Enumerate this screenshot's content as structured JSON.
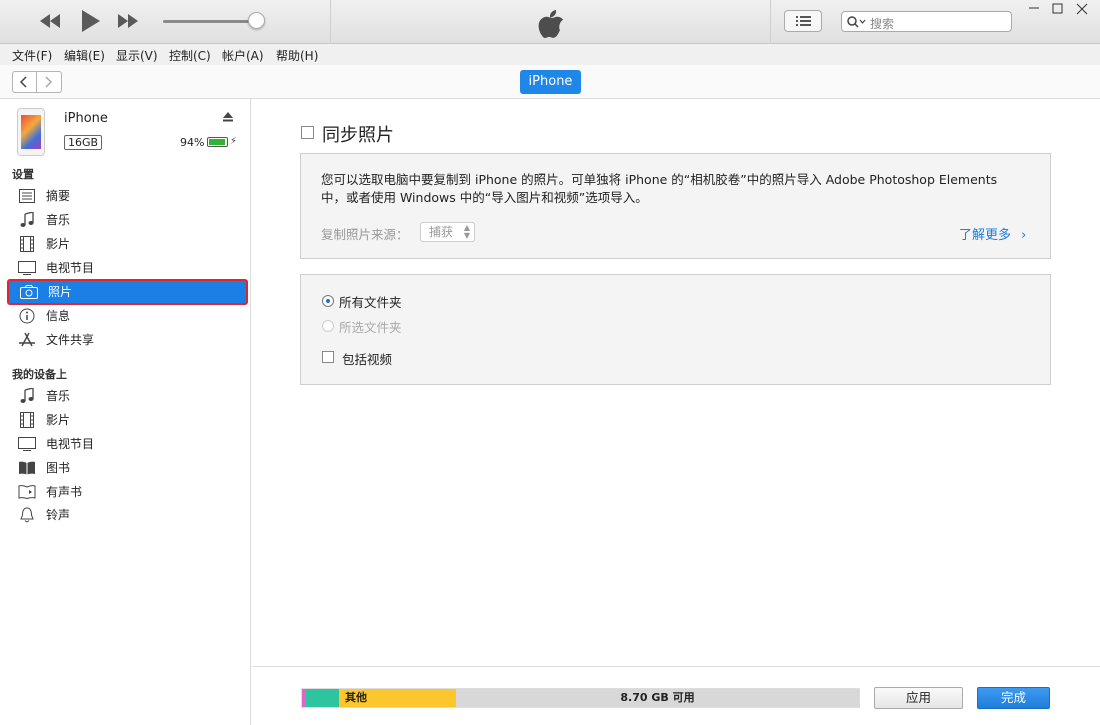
{
  "search": {
    "placeholder": "搜索"
  },
  "menu": [
    "文件(F)",
    "编辑(E)",
    "显示(V)",
    "控制(C)",
    "帐户(A)",
    "帮助(H)"
  ],
  "nav": {
    "device_pill": "iPhone"
  },
  "device": {
    "name": "iPhone",
    "capacity": "16GB",
    "battery_pct": "94%",
    "battery_level": 0.94
  },
  "sidebar": {
    "settings_header": "设置",
    "settings_items": [
      {
        "label": "摘要",
        "icon": "list-icon"
      },
      {
        "label": "音乐",
        "icon": "music-note-icon"
      },
      {
        "label": "影片",
        "icon": "film-icon"
      },
      {
        "label": "电视节目",
        "icon": "tv-icon"
      },
      {
        "label": "照片",
        "icon": "camera-icon",
        "selected": true
      },
      {
        "label": "信息",
        "icon": "info-icon"
      },
      {
        "label": "文件共享",
        "icon": "app-store-icon"
      }
    ],
    "device_header": "我的设备上",
    "device_items": [
      {
        "label": "音乐",
        "icon": "music-note-icon"
      },
      {
        "label": "影片",
        "icon": "film-icon"
      },
      {
        "label": "电视节目",
        "icon": "tv-icon"
      },
      {
        "label": "图书",
        "icon": "book-icon"
      },
      {
        "label": "有声书",
        "icon": "audiobook-icon"
      },
      {
        "label": "铃声",
        "icon": "bell-icon"
      }
    ]
  },
  "main": {
    "sync_title": "同步照片",
    "description": "您可以选取电脑中要复制到 iPhone 的照片。可单独将 iPhone 的“相机胶卷”中的照片导入 Adobe Photoshop Elements 中，或者使用 Windows 中的“导入图片和视频”选项导入。",
    "source_label": "复制照片来源：",
    "source_value": "捕获",
    "learn_more": "了解更多",
    "opt_all": "所有文件夹",
    "opt_selected": "所选文件夹",
    "opt_video": "包括视频"
  },
  "storage": {
    "other_label": "其他",
    "free_label": "8.70 GB 可用"
  },
  "buttons": {
    "apply": "应用",
    "done": "完成"
  },
  "colors": {
    "accent": "#1f87e8",
    "selected": "#1a80e5",
    "highlight_border": "#e0262f"
  }
}
